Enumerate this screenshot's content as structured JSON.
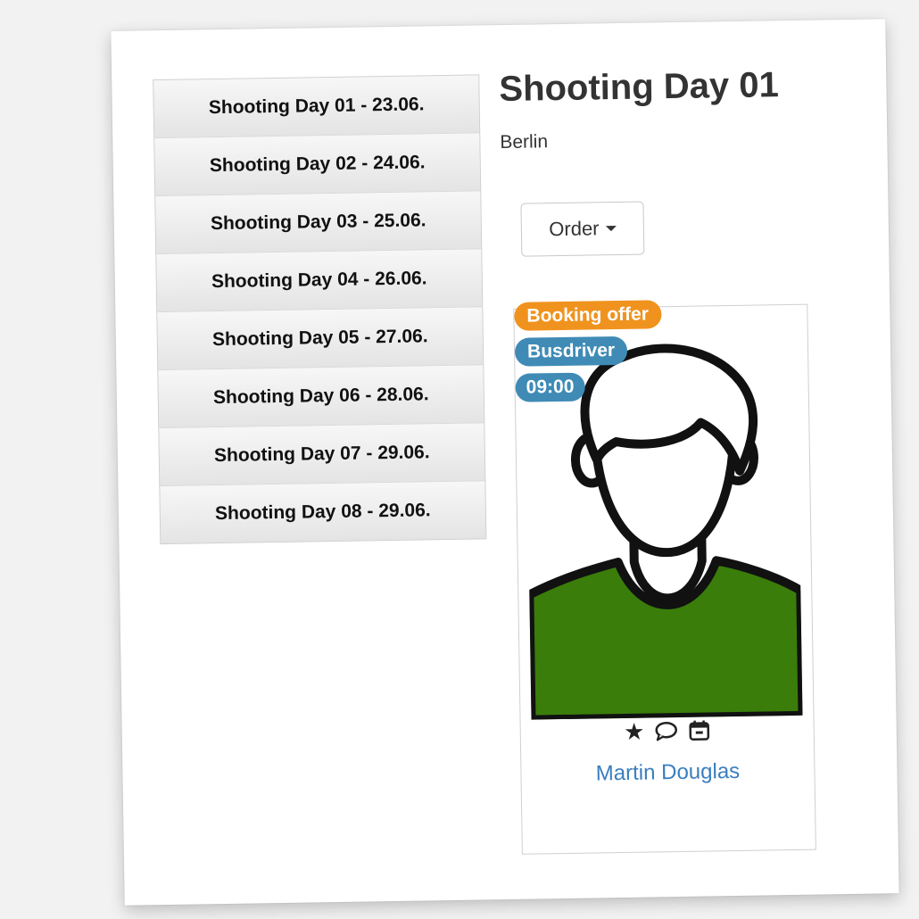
{
  "sidebar": {
    "days": [
      {
        "label": "Shooting Day 01 - 23.06."
      },
      {
        "label": "Shooting Day 02 - 24.06."
      },
      {
        "label": "Shooting Day 03 - 25.06."
      },
      {
        "label": "Shooting Day 04 - 26.06."
      },
      {
        "label": "Shooting Day 05 - 27.06."
      },
      {
        "label": "Shooting Day 06 - 28.06."
      },
      {
        "label": "Shooting Day 07 - 29.06."
      },
      {
        "label": "Shooting Day 08 - 29.06."
      }
    ]
  },
  "main": {
    "title": "Shooting Day 01",
    "location": "Berlin",
    "order_button": "Order"
  },
  "card": {
    "badges": {
      "status": "Booking offer",
      "role": "Busdriver",
      "time": "09:00"
    },
    "name": "Martin Douglas",
    "icons": [
      "star-icon",
      "comment-icon",
      "calendar-icon"
    ]
  },
  "colors": {
    "badge_orange": "#f0931e",
    "badge_blue": "#3f8bb6",
    "shirt_green": "#3a7d0a",
    "link_blue": "#3a7ebf"
  }
}
